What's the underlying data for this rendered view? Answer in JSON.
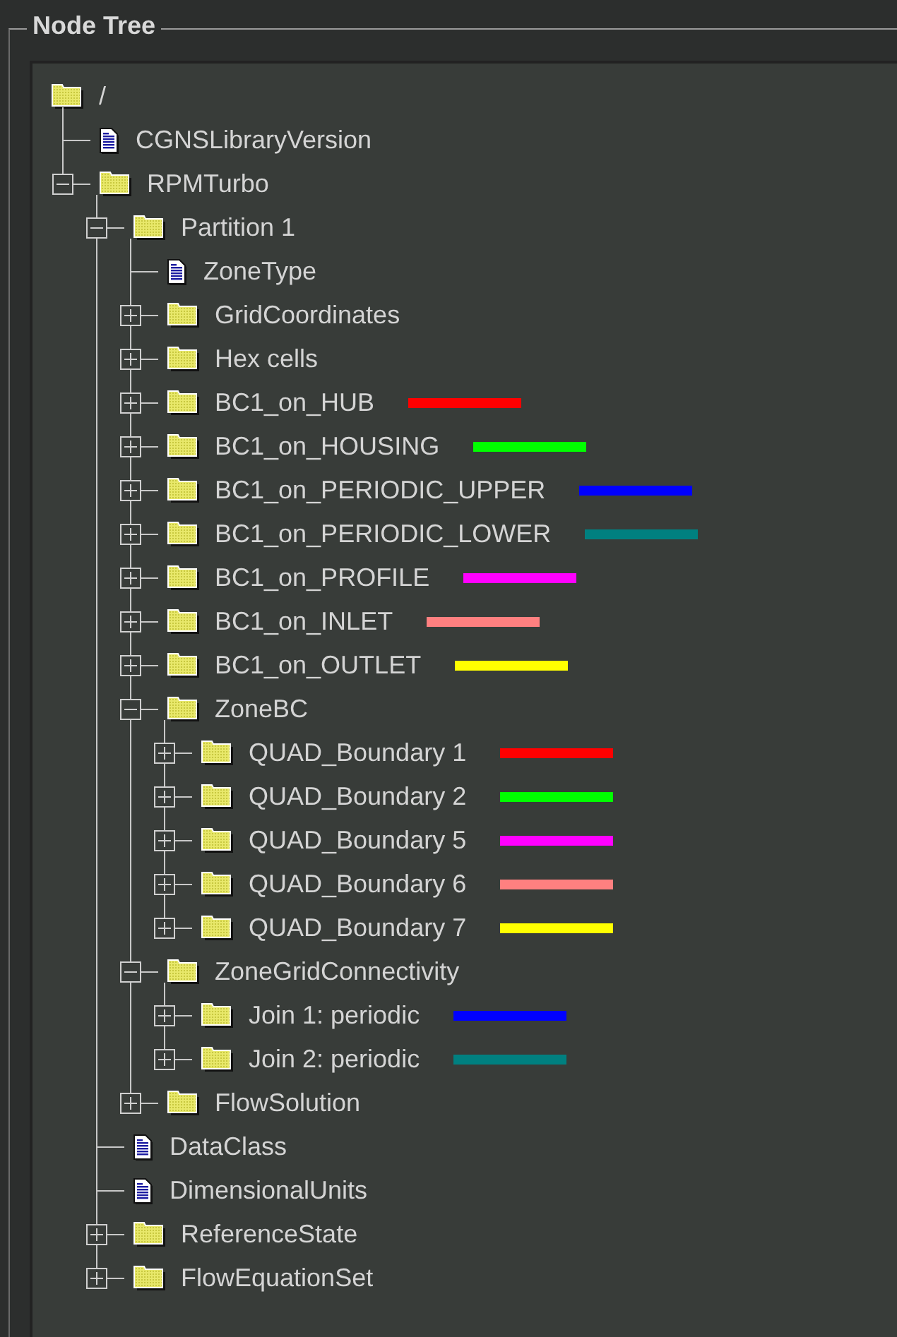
{
  "panel": {
    "title": "Node Tree"
  },
  "tree": {
    "label": "/",
    "kind": "folder",
    "children": [
      {
        "label": "CGNSLibraryVersion",
        "kind": "file"
      },
      {
        "label": "RPMTurbo",
        "kind": "folder",
        "expanded": true,
        "children": [
          {
            "label": "Partition 1",
            "kind": "folder",
            "expanded": true,
            "children": [
              {
                "label": "ZoneType",
                "kind": "file"
              },
              {
                "label": "GridCoordinates",
                "kind": "folder",
                "expanded": false
              },
              {
                "label": "Hex cells",
                "kind": "folder",
                "expanded": false
              },
              {
                "label": "BC1_on_HUB",
                "kind": "folder",
                "expanded": false,
                "color": "#ff0000"
              },
              {
                "label": "BC1_on_HOUSING",
                "kind": "folder",
                "expanded": false,
                "color": "#00ff00"
              },
              {
                "label": "BC1_on_PERIODIC_UPPER",
                "kind": "folder",
                "expanded": false,
                "color": "#0000ff"
              },
              {
                "label": "BC1_on_PERIODIC_LOWER",
                "kind": "folder",
                "expanded": false,
                "color": "#008080"
              },
              {
                "label": "BC1_on_PROFILE",
                "kind": "folder",
                "expanded": false,
                "color": "#ff00ff"
              },
              {
                "label": "BC1_on_INLET",
                "kind": "folder",
                "expanded": false,
                "color": "#ff8080"
              },
              {
                "label": "BC1_on_OUTLET",
                "kind": "folder",
                "expanded": false,
                "color": "#ffff00"
              },
              {
                "label": "ZoneBC",
                "kind": "folder",
                "expanded": true,
                "children": [
                  {
                    "label": "QUAD_Boundary 1",
                    "kind": "folder",
                    "expanded": false,
                    "color": "#ff0000"
                  },
                  {
                    "label": "QUAD_Boundary 2",
                    "kind": "folder",
                    "expanded": false,
                    "color": "#00ff00"
                  },
                  {
                    "label": "QUAD_Boundary 5",
                    "kind": "folder",
                    "expanded": false,
                    "color": "#ff00ff"
                  },
                  {
                    "label": "QUAD_Boundary 6",
                    "kind": "folder",
                    "expanded": false,
                    "color": "#ff8080"
                  },
                  {
                    "label": "QUAD_Boundary 7",
                    "kind": "folder",
                    "expanded": false,
                    "color": "#ffff00"
                  }
                ]
              },
              {
                "label": "ZoneGridConnectivity",
                "kind": "folder",
                "expanded": true,
                "children": [
                  {
                    "label": "Join 1: periodic",
                    "kind": "folder",
                    "expanded": false,
                    "color": "#0000ff"
                  },
                  {
                    "label": "Join 2: periodic",
                    "kind": "folder",
                    "expanded": false,
                    "color": "#008080"
                  }
                ]
              },
              {
                "label": "FlowSolution",
                "kind": "folder",
                "expanded": false
              }
            ]
          },
          {
            "label": "DataClass",
            "kind": "file"
          },
          {
            "label": "DimensionalUnits",
            "kind": "file"
          },
          {
            "label": "ReferenceState",
            "kind": "folder",
            "expanded": false
          },
          {
            "label": "FlowEquationSet",
            "kind": "folder",
            "expanded": false
          }
        ]
      }
    ]
  }
}
